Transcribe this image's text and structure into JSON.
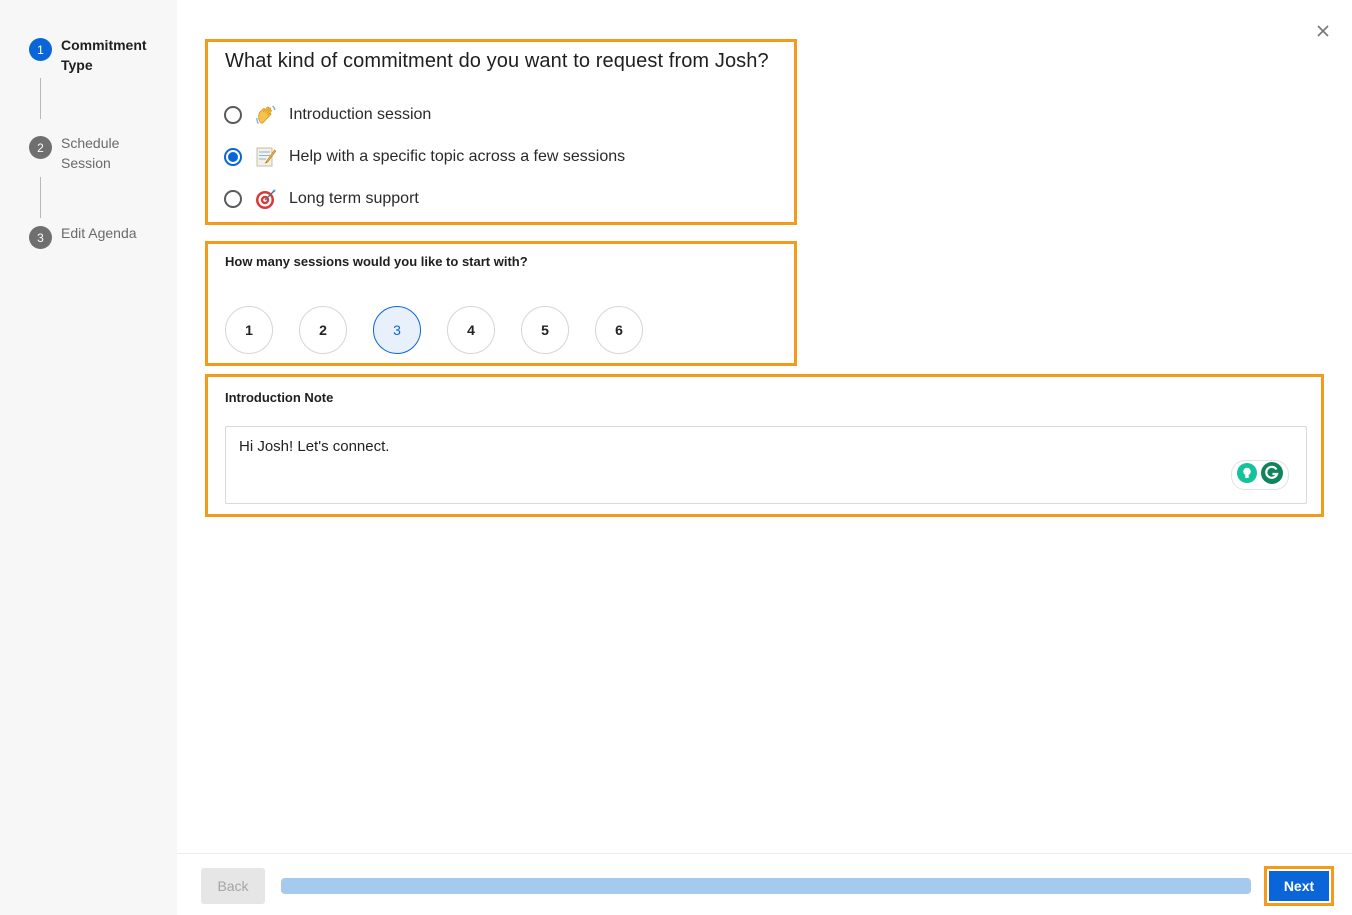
{
  "sidebar": {
    "steps": [
      {
        "num": "1",
        "label": "Commitment Type",
        "active": true
      },
      {
        "num": "2",
        "label": "Schedule Session",
        "active": false
      },
      {
        "num": "3",
        "label": "Edit Agenda",
        "active": false
      }
    ]
  },
  "commitment": {
    "question": "What kind of commitment do you want to request from Josh?",
    "options": [
      {
        "emoji": "waving-hand-icon",
        "label": "Introduction session",
        "selected": false
      },
      {
        "emoji": "memo-icon",
        "label": "Help with a specific topic across a few sessions",
        "selected": true
      },
      {
        "emoji": "direct-hit-icon",
        "label": "Long term support",
        "selected": false
      }
    ]
  },
  "sessions": {
    "question": "How many sessions would you like to start with?",
    "choices": [
      "1",
      "2",
      "3",
      "4",
      "5",
      "6"
    ],
    "selected": "3"
  },
  "note": {
    "title": "Introduction Note",
    "value": "Hi Josh! Let's connect."
  },
  "footer": {
    "back_label": "Back",
    "next_label": "Next",
    "progress": 1.0
  },
  "colors": {
    "accent": "#0a66d8",
    "highlight": "#f59b1c",
    "progress": "#a6c9ee"
  }
}
